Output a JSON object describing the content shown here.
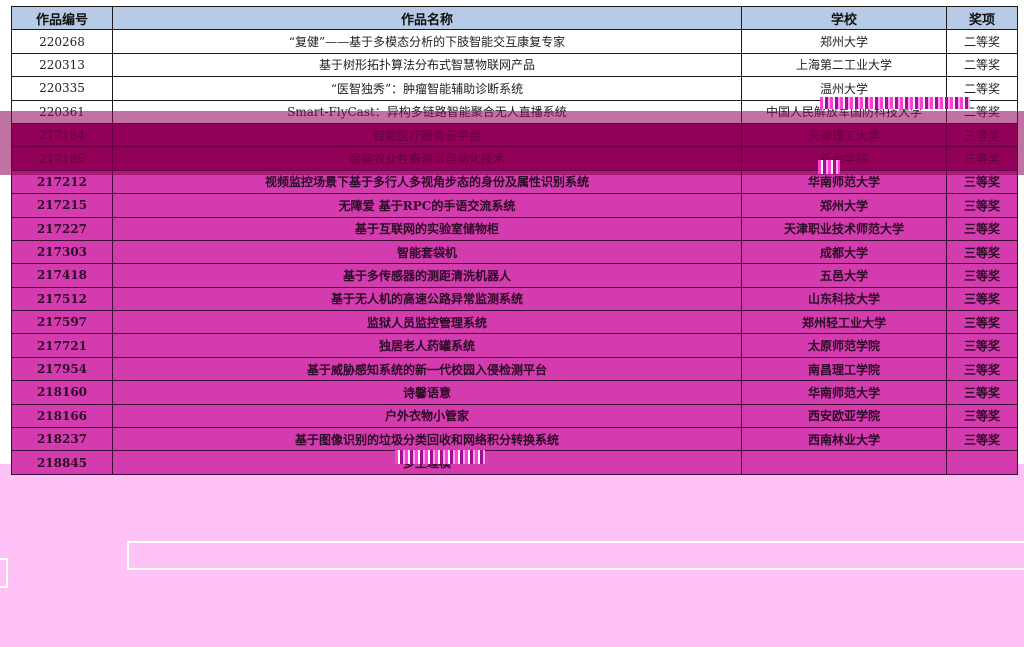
{
  "table": {
    "headers": [
      "作品编号",
      "作品名称",
      "学校",
      "奖项"
    ],
    "rows": [
      {
        "id": "220268",
        "name": "“复健”——基于多模态分析的下肢智能交互康复专家",
        "school": "郑州大学",
        "award": "二等奖"
      },
      {
        "id": "220313",
        "name": "基于树形拓扑算法分布式智慧物联网产品",
        "school": "上海第二工业大学",
        "award": "二等奖"
      },
      {
        "id": "220335",
        "name": "“医智独秀”：肿瘤智能辅助诊断系统",
        "school": "温州大学",
        "award": "二等奖"
      },
      {
        "id": "220361",
        "name": "Smart-FlyCast：异构多链路智能聚合无人直播系统",
        "school": "中国人民解放军国防科技大学",
        "award": "二等奖"
      },
      {
        "id": "217184",
        "name": "智能医疗服务云平台",
        "school": "天津理工大学",
        "award": "三等奖"
      },
      {
        "id": "217185",
        "name": "智能农业牲畜测温自动化技术",
        "school": "新余学院",
        "award": "三等奖"
      },
      {
        "id": "217212",
        "name": "视频监控场景下基于多行人多视角步态的身份及属性识别系统",
        "school": "华南师范大学",
        "award": "三等奖"
      },
      {
        "id": "217215",
        "name": "无障爱  基于RPC的手语交流系统",
        "school": "郑州大学",
        "award": "三等奖"
      },
      {
        "id": "217227",
        "name": "基于互联网的实验室储物柜",
        "school": "天津职业技术师范大学",
        "award": "三等奖"
      },
      {
        "id": "217303",
        "name": "智能套袋机",
        "school": "成都大学",
        "award": "三等奖"
      },
      {
        "id": "217418",
        "name": "基于多传感器的测距清洗机器人",
        "school": "五邑大学",
        "award": "三等奖"
      },
      {
        "id": "217512",
        "name": "基于无人机的高速公路异常监测系统",
        "school": "山东科技大学",
        "award": "三等奖"
      },
      {
        "id": "217597",
        "name": "监狱人员监控管理系统",
        "school": "郑州轻工业大学",
        "award": "三等奖"
      },
      {
        "id": "217721",
        "name": "独居老人药罐系统",
        "school": "太原师范学院",
        "award": "三等奖"
      },
      {
        "id": "217954",
        "name": "基于威胁感知系统的新一代校园入侵检测平台",
        "school": "南昌理工学院",
        "award": "三等奖"
      },
      {
        "id": "218160",
        "name": "诗馨语意",
        "school": "华南师范大学",
        "award": "三等奖"
      },
      {
        "id": "218166",
        "name": "户外衣物小管家",
        "school": "西安欧亚学院",
        "award": "三等奖"
      },
      {
        "id": "218237",
        "name": "基于图像识别的垃圾分类回收和网络积分转换系统",
        "school": "西南林业大学",
        "award": "三等奖"
      },
      {
        "id": "218845",
        "name": "多生理模",
        "school": "",
        "award": ""
      }
    ]
  },
  "colors": {
    "header_bg": "#b8cbe6",
    "highlight_row": "#d33bae",
    "page_bg": "#ffc2f7"
  }
}
